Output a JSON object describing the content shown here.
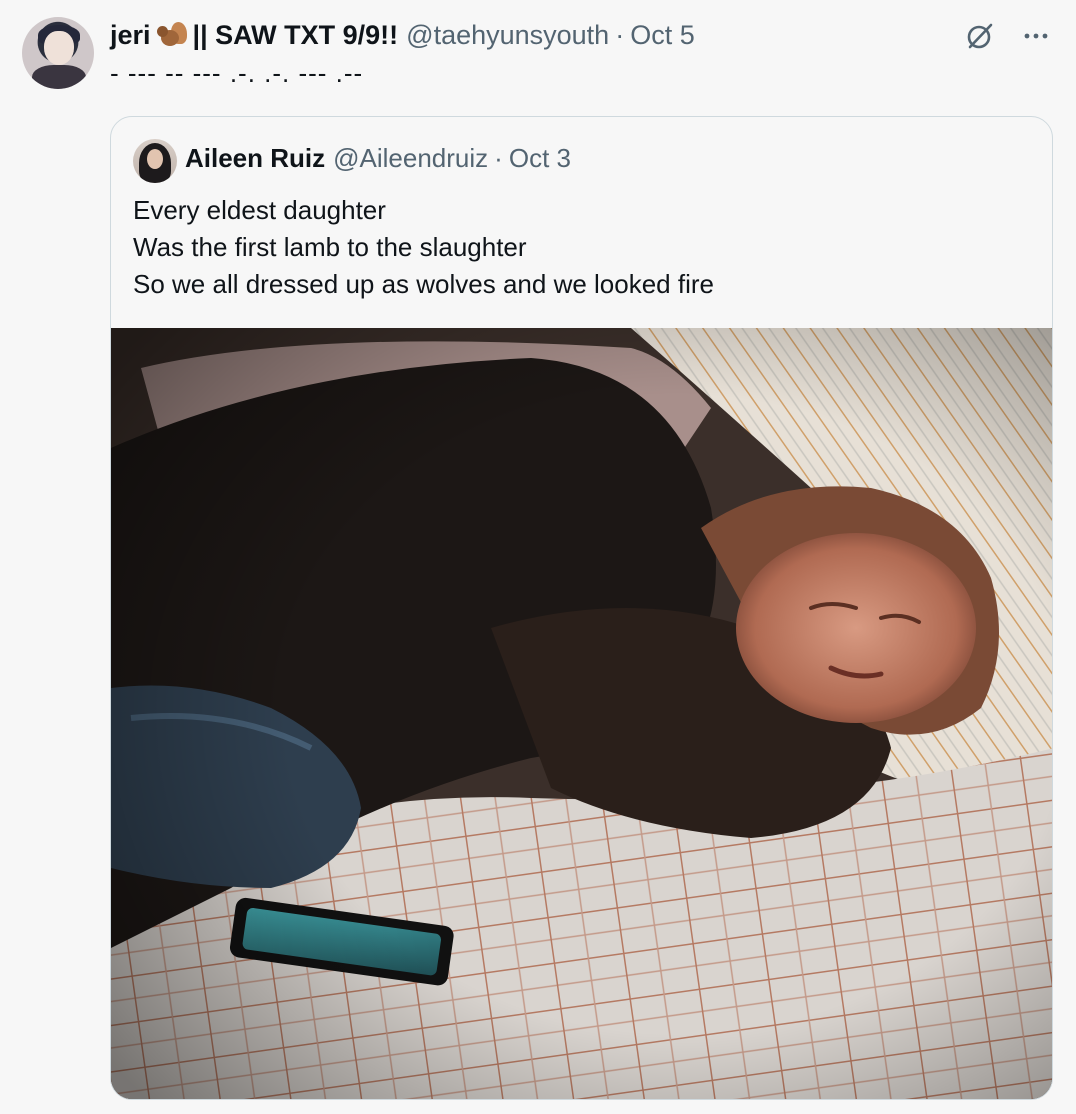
{
  "tweet": {
    "author": {
      "display_name": "jeri",
      "display_name_emoji": "squirrel-emoji",
      "display_name_rest": "|| SAW TXT 9/9!!",
      "handle": "@taehyunsyouth",
      "separator": "·",
      "time": "Oct 5"
    },
    "text": "- --- -- --- .-. .-. --- .--",
    "actions": {
      "icons": [
        "grok-icon",
        "more-icon"
      ]
    },
    "quote": {
      "author": {
        "display_name": "Aileen Ruiz",
        "handle": "@Aileendruiz",
        "separator": "·",
        "time": "Oct 3"
      },
      "lines": [
        "Every eldest daughter",
        "Was the first lamb to the slaughter",
        "So we all dressed up as wolves and we looked fire"
      ]
    }
  },
  "colors": {
    "background": "#f7f7f7",
    "text_primary": "#0f1419",
    "text_secondary": "#536471",
    "border": "#cfd9de"
  }
}
